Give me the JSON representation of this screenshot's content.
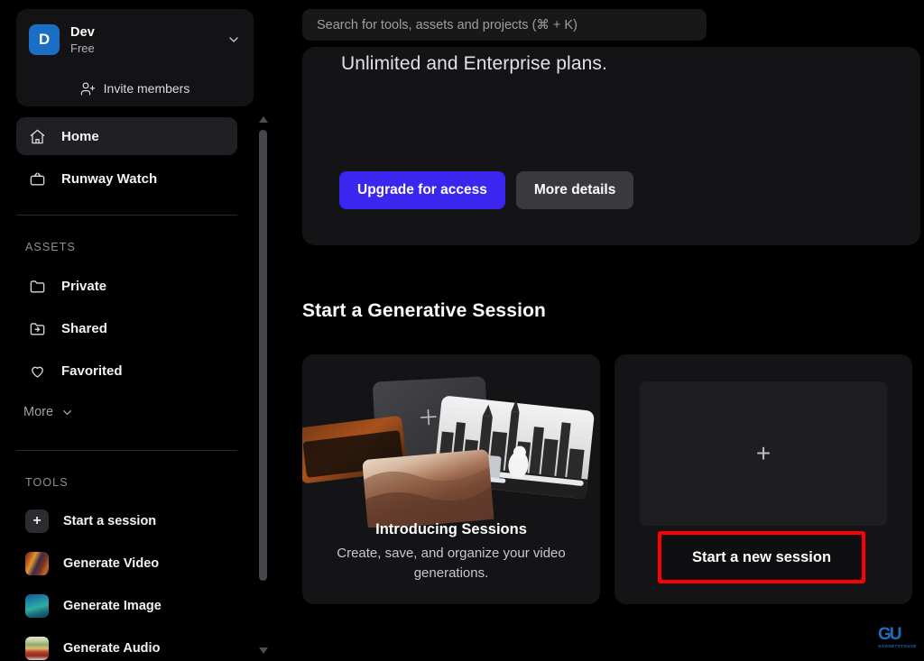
{
  "app": {
    "name": "Runway",
    "background": "#000000"
  },
  "colors": {
    "accent_blue": "#3b26f0",
    "avatar_blue": "#1a6fc4",
    "annotation_red": "#ff0000",
    "card_bg": "#141416",
    "active_nav_bg": "#202024"
  },
  "sidebar": {
    "workspace": {
      "avatar_letter": "D",
      "name": "Dev",
      "plan": "Free",
      "chevron_icon": "chevron-down-icon",
      "invite_label": "Invite members",
      "invite_icon": "person-add-icon"
    },
    "nav": [
      {
        "label": "Home",
        "icon": "home-icon",
        "active": true
      },
      {
        "label": "Runway Watch",
        "icon": "tv-icon",
        "active": false
      }
    ],
    "assets_heading": "ASSETS",
    "assets": [
      {
        "label": "Private",
        "icon": "folder-icon"
      },
      {
        "label": "Shared",
        "icon": "folder-shared-icon"
      },
      {
        "label": "Favorited",
        "icon": "heart-icon"
      }
    ],
    "more_label": "More",
    "more_icon": "chevron-down-icon",
    "tools_heading": "TOOLS",
    "tools": [
      {
        "label": "Start a session",
        "icon": "plus-icon"
      },
      {
        "label": "Generate Video",
        "icon": "video-thumbnail-icon"
      },
      {
        "label": "Generate Image",
        "icon": "image-thumbnail-icon"
      },
      {
        "label": "Generate Audio",
        "icon": "audio-thumbnail-icon"
      }
    ],
    "scrollbar": {
      "up_icon": "scroll-up-arrow-icon",
      "down_icon": "scroll-down-arrow-icon"
    }
  },
  "header": {
    "search_placeholder": "Search for tools, assets and projects (⌘ + K)",
    "search_value": ""
  },
  "promo": {
    "text_line": "Unlimited and Enterprise plans.",
    "primary_button": "Upgrade for access",
    "secondary_button": "More details"
  },
  "main": {
    "section_title": "Start a Generative Session",
    "cards": [
      {
        "title": "Introducing Sessions",
        "subtitle": "Create, save, and organize your video generations.",
        "media": "sessions-collage-illustration"
      },
      {
        "placeholder_icon": "plus-icon",
        "button_label": "Start a new session",
        "highlighted": true
      }
    ]
  },
  "watermark": {
    "mark": "GU",
    "sub": "GADGETSTOUSE"
  }
}
